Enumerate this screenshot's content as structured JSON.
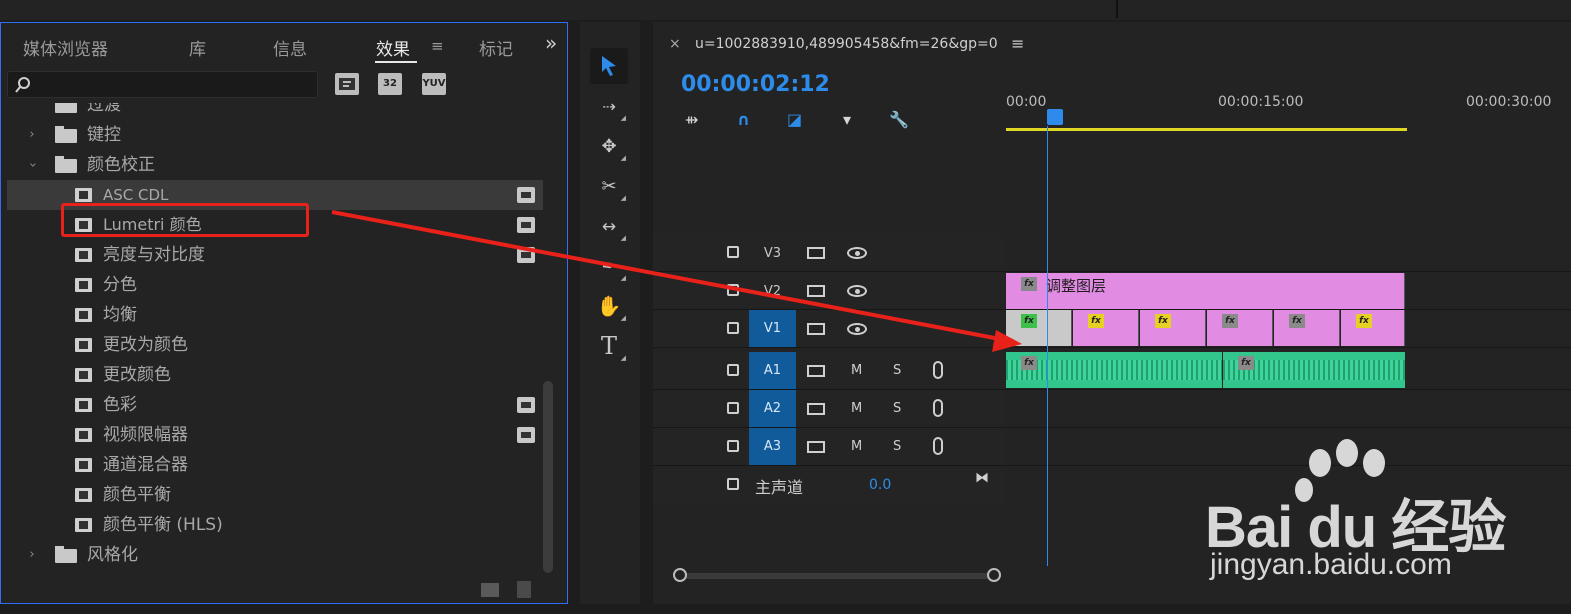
{
  "panel": {
    "tabs": [
      "媒体浏览器",
      "库",
      "信息",
      "效果",
      "标记"
    ],
    "more_label": "»",
    "menu_icon": "hamburger-icon",
    "search_icon": "search-icon",
    "filters": [
      "32",
      "YUV"
    ]
  },
  "tree": [
    {
      "label": "过渡",
      "type": "folder",
      "expanded": false
    },
    {
      "label": "键控",
      "type": "folder",
      "expanded": false
    },
    {
      "label": "颜色校正",
      "type": "folder",
      "expanded": true
    },
    {
      "label": "ASC CDL",
      "type": "effect",
      "accel": true,
      "selected": true
    },
    {
      "label": "Lumetri 颜色",
      "type": "effect",
      "accel": true
    },
    {
      "label": "亮度与对比度",
      "type": "effect",
      "accel": true
    },
    {
      "label": "分色",
      "type": "effect",
      "accel": false
    },
    {
      "label": "均衡",
      "type": "effect",
      "accel": false
    },
    {
      "label": "更改为颜色",
      "type": "effect",
      "accel": false
    },
    {
      "label": "更改颜色",
      "type": "effect",
      "accel": false
    },
    {
      "label": "色彩",
      "type": "effect",
      "accel": true
    },
    {
      "label": "视频限幅器",
      "type": "effect",
      "accel": true
    },
    {
      "label": "通道混合器",
      "type": "effect",
      "accel": false
    },
    {
      "label": "颜色平衡",
      "type": "effect",
      "accel": false
    },
    {
      "label": "颜色平衡 (HLS)",
      "type": "effect",
      "accel": false
    },
    {
      "label": "风格化",
      "type": "folder",
      "expanded": false
    }
  ],
  "tools": [
    "selection-tool",
    "track-select-tool",
    "ripple-edit-tool",
    "razor-tool",
    "slip-tool",
    "pen-tool",
    "hand-tool",
    "type-tool"
  ],
  "timeline": {
    "close": "×",
    "sequence_name": "u=1002883910,489905458&fm=26&gp=0",
    "menu": "≡",
    "timecode": "00:00:02:12",
    "ruler": [
      "00:00",
      "00:00:15:00",
      "00:00:30:00"
    ],
    "tracks": {
      "v3": "V3",
      "v2": "V2",
      "v1": "V1",
      "a1": "A1",
      "a2": "A2",
      "a3": "A3",
      "m": "M",
      "s": "S"
    },
    "adjustment_layer": "调整图层",
    "fx_label": "fx",
    "master_label": "主声道",
    "master_value": "0.0"
  },
  "watermark": {
    "brand": "Bai du 经验",
    "url": "jingyan.baidu.com"
  },
  "colors": {
    "accent": "#2d8ceb",
    "highlight_box": "#e8211b",
    "video_clip": "#e18be3",
    "audio_clip": "#32c68d",
    "work_area": "#e0d624"
  }
}
